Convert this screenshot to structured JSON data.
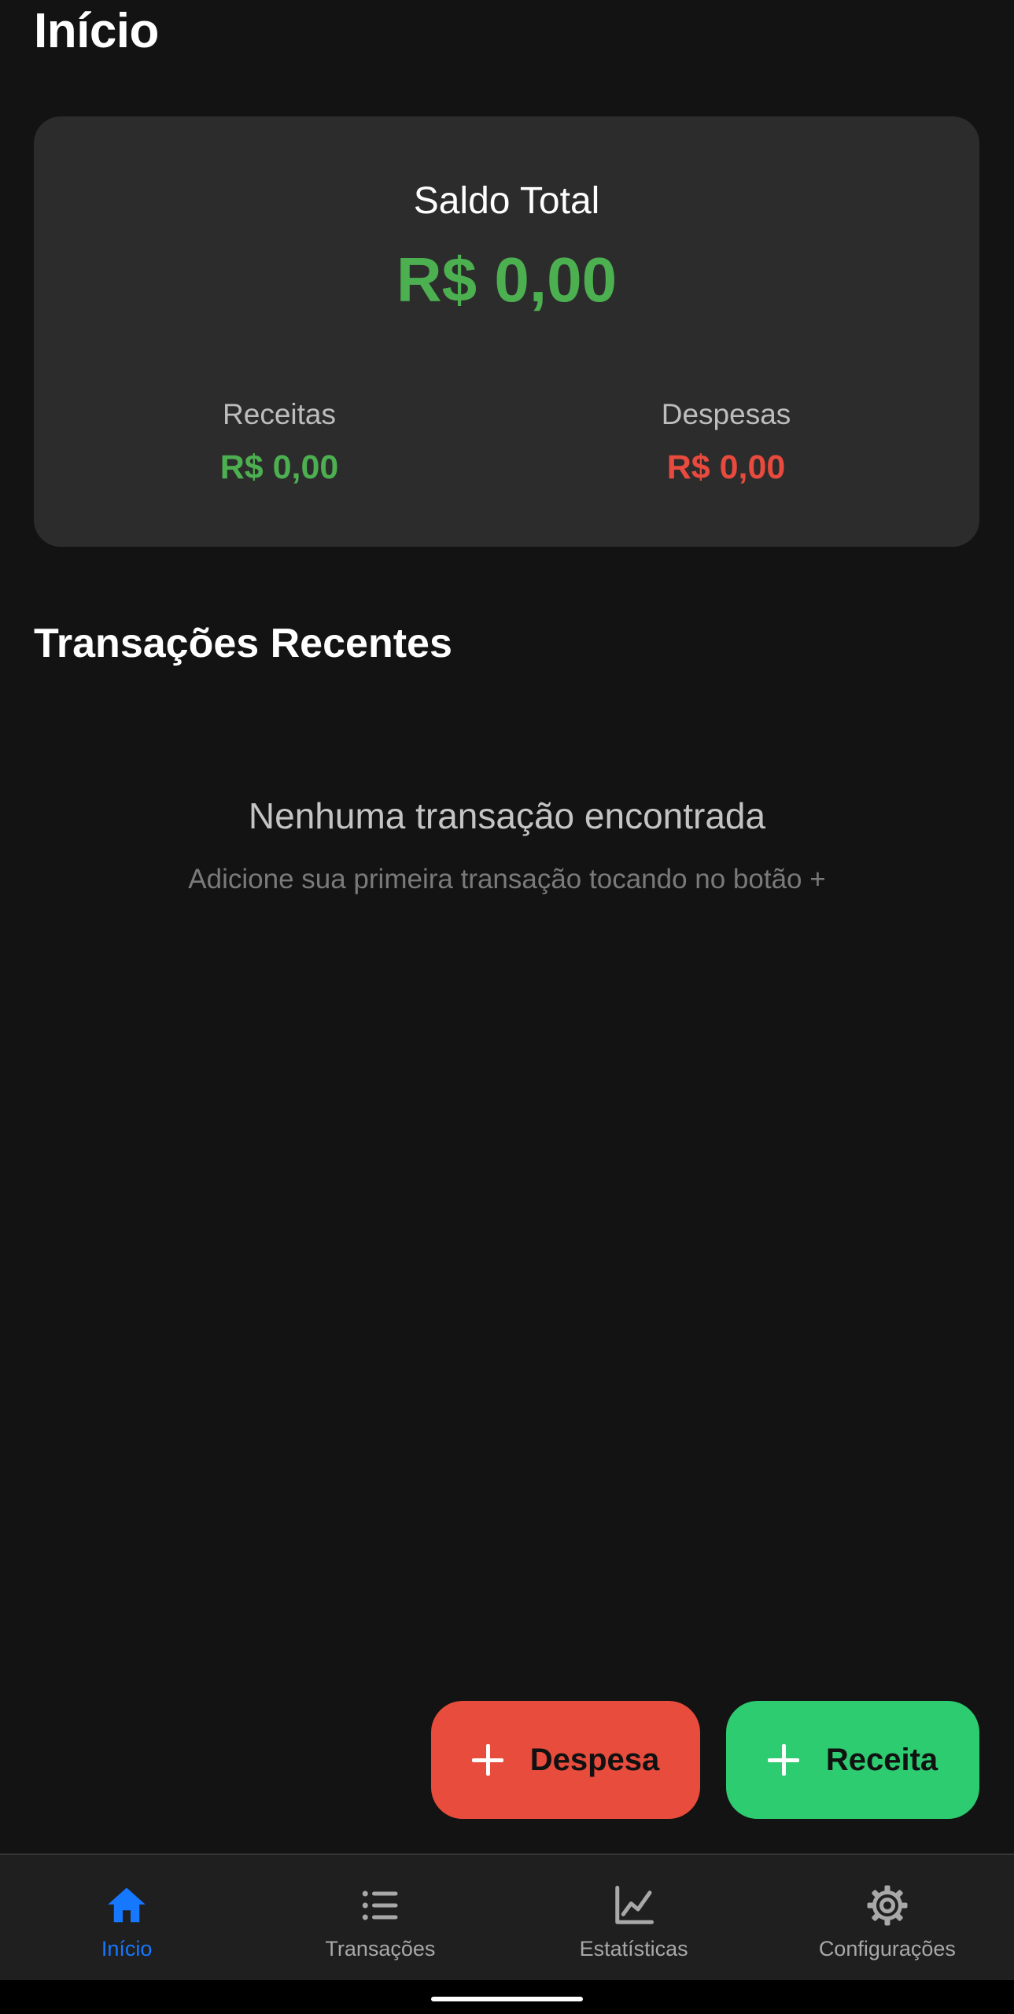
{
  "header": {
    "title": "Início"
  },
  "balance": {
    "label": "Saldo Total",
    "value": "R$ 0,00",
    "income_label": "Receitas",
    "income_value": "R$ 0,00",
    "expense_label": "Despesas",
    "expense_value": "R$ 0,00"
  },
  "recent": {
    "title": "Transações Recentes",
    "empty_title": "Nenhuma transação encontrada",
    "empty_hint": "Adicione sua primeira transação tocando no botão +"
  },
  "actions": {
    "expense_label": "Despesa",
    "income_label": "Receita"
  },
  "nav": {
    "items": [
      {
        "label": "Início",
        "icon": "home-icon",
        "active": true
      },
      {
        "label": "Transações",
        "icon": "list-icon",
        "active": false
      },
      {
        "label": "Estatísticas",
        "icon": "chart-line-icon",
        "active": false
      },
      {
        "label": "Configurações",
        "icon": "gear-icon",
        "active": false
      }
    ]
  },
  "colors": {
    "background": "#131313",
    "card": "#2c2c2c",
    "income": "#4caf50",
    "expense": "#e84a3d",
    "income_button": "#2ecc71",
    "expense_button": "#e74c3c",
    "nav_active": "#1677ff",
    "nav_inactive": "#a8a8a8"
  }
}
